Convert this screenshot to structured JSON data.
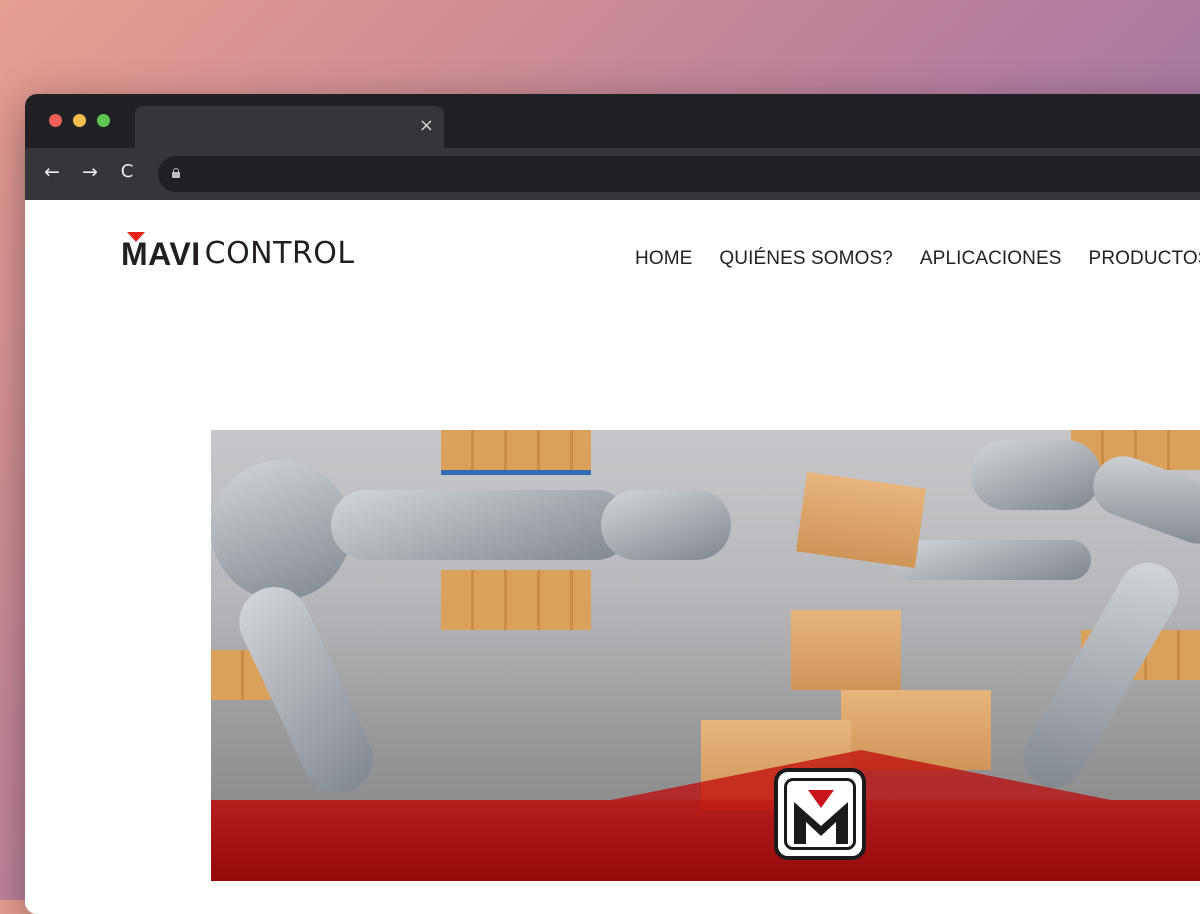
{
  "browser": {
    "tab": {
      "title": "",
      "close_glyph": "×"
    },
    "toolbar": {
      "back_glyph": "←",
      "forward_glyph": "→",
      "reload_glyph": "C",
      "address": ""
    }
  },
  "site": {
    "logo": {
      "part1": "MAVI",
      "part2": "CONTROL",
      "accent_color": "#e2231a"
    },
    "nav": [
      {
        "label": "HOME"
      },
      {
        "label": "QUIÉNES SOMOS?"
      },
      {
        "label": "APLICACIONES"
      },
      {
        "label": "PRODUCTOS"
      }
    ],
    "hero": {
      "image": "robotic-arms-warehouse-conveyor",
      "brand_color": "#c00a0a"
    }
  }
}
